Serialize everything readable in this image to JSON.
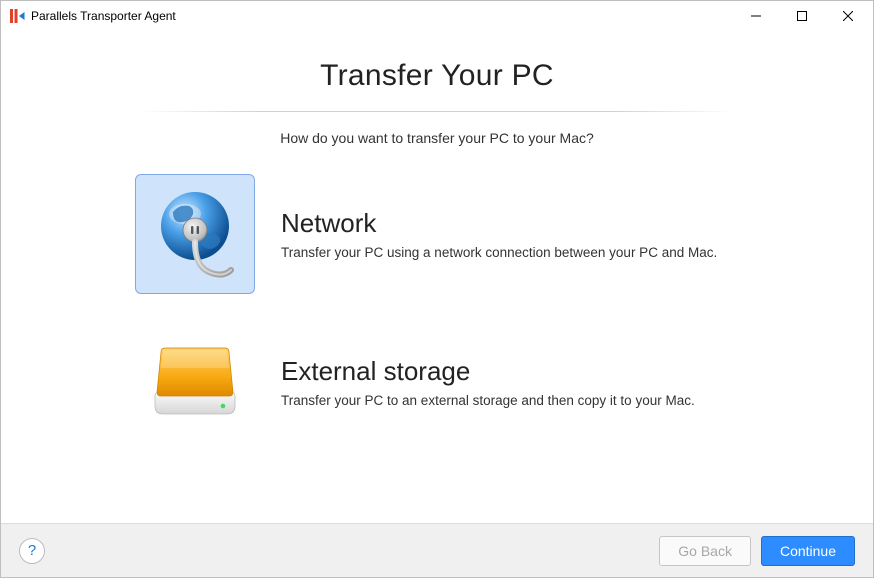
{
  "window": {
    "title": "Parallels Transporter Agent"
  },
  "main": {
    "heading": "Transfer Your PC",
    "subtitle": "How do you want to transfer your PC to your Mac?"
  },
  "options": {
    "network": {
      "title": "Network",
      "description": "Transfer your PC using a network connection between your PC and Mac.",
      "selected": true
    },
    "external": {
      "title": "External storage",
      "description": "Transfer your PC to an external storage and then copy it to your Mac.",
      "selected": false
    }
  },
  "footer": {
    "go_back_label": "Go Back",
    "continue_label": "Continue"
  }
}
